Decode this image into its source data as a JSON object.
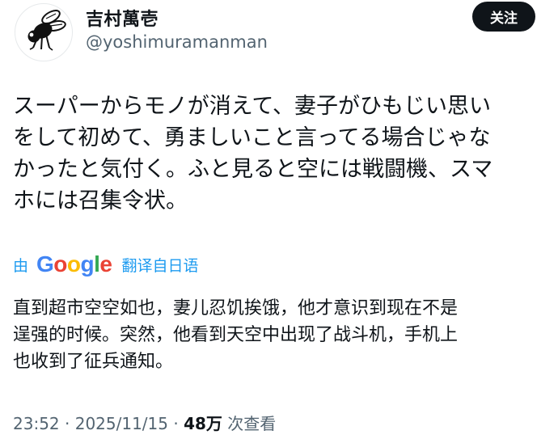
{
  "header": {
    "display_name": "吉村萬壱",
    "handle": "@yoshimuramanman",
    "follow_label": "关注",
    "avatar_icon": "fly-icon"
  },
  "tweet": {
    "lines": [
      "スーパーからモノが消えて、妻子がひもじい思い",
      "をして初めて、勇ましいこと言ってる場合じゃな",
      "かったと気付く。ふと見ると空には戦闘機、スマ",
      "ホには召集令状。"
    ]
  },
  "translation": {
    "by": "由",
    "logo_text": "Google",
    "from": "翻译自日语",
    "lines": [
      "直到超市空空如也，妻儿忍饥挨饿，他才意识到现在不是",
      "逞强的时候。突然，他看到天空中出现了战斗机，手机上",
      "也收到了征兵通知。"
    ]
  },
  "meta": {
    "time": "23:52",
    "sep1": "·",
    "date": "2025/11/15",
    "sep2": "·",
    "views": "48万",
    "views_label": "次查看"
  },
  "colors": {
    "text": "#0f1419",
    "secondary": "#536471",
    "link": "#1d9bf0",
    "button": "#0f1419",
    "google_blue": "#4285f4",
    "google_red": "#ea4335",
    "google_yellow": "#fbbc05",
    "google_green": "#34a853"
  }
}
